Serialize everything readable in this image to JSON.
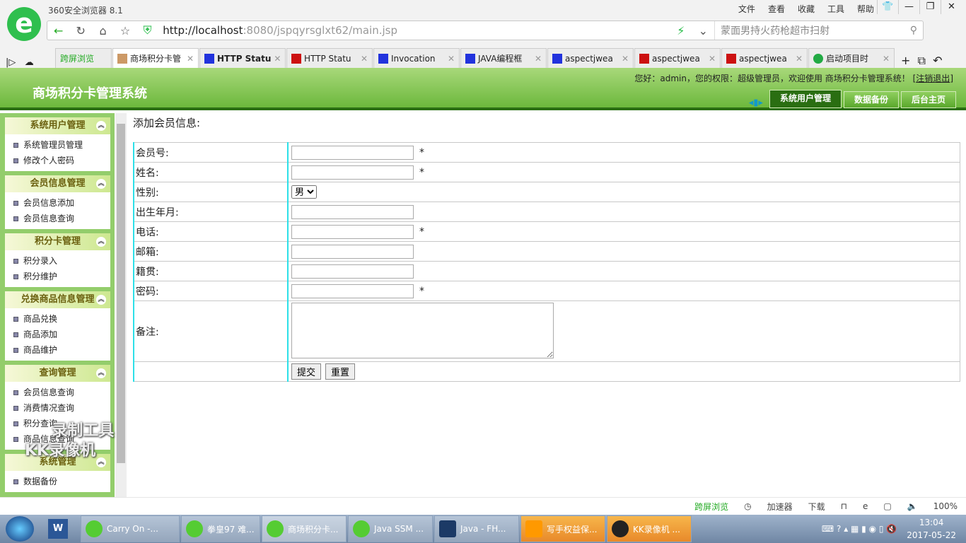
{
  "browser": {
    "title": "360安全浏览器 8.1",
    "menu": [
      "文件",
      "查看",
      "收藏",
      "工具",
      "帮助"
    ],
    "url_host": "http://localhost",
    "url_rest": ":8080/jspqyrsglxt62/main.jsp",
    "search_placeholder": "蒙面男持火药枪超市扫射",
    "tabs": [
      "跨屏浏览",
      "商场积分卡管",
      "HTTP Statu",
      "HTTP Statu",
      "Invocation",
      "JAVA编程框",
      "aspectjwea",
      "aspectjwea",
      "aspectjwea",
      "启动项目时"
    ],
    "status": {
      "crossscreen": "跨屏浏览",
      "accelerator": "加速器",
      "download": "下载",
      "zoom": "100%"
    }
  },
  "header": {
    "title": "商场积分卡管理系统",
    "welcome": "您好：admin，您的权限：超级管理员，欢迎使用 商场积分卡管理系统！",
    "logout": "注销退出",
    "nav": [
      "系统用户管理",
      "数据备份",
      "后台主页"
    ]
  },
  "sidebar": [
    {
      "title": "系统用户管理",
      "items": [
        "系统管理员管理",
        "修改个人密码"
      ]
    },
    {
      "title": "会员信息管理",
      "items": [
        "会员信息添加",
        "会员信息查询"
      ]
    },
    {
      "title": "积分卡管理",
      "items": [
        "积分录入",
        "积分维护"
      ]
    },
    {
      "title": "兑换商品信息管理",
      "items": [
        "商品兑换",
        "商品添加",
        "商品维护"
      ]
    },
    {
      "title": "查询管理",
      "items": [
        "会员信息查询",
        "消费情况查询",
        "积分查询",
        "商品信息查询"
      ]
    },
    {
      "title": "系统管理",
      "items": [
        "数据备份"
      ]
    }
  ],
  "form": {
    "title": "添加会员信息:",
    "fields": {
      "member_no": "会员号:",
      "name": "姓名:",
      "gender": "性别:",
      "birth": "出生年月:",
      "phone": "电话:",
      "email": "邮箱:",
      "hometown": "籍贯:",
      "password": "密码:",
      "remark": "备注:"
    },
    "required_mark": "*",
    "gender_value": "男",
    "submit": "提交",
    "reset": "重置"
  },
  "watermark": "录制工具 KK录像机",
  "taskbar": {
    "items": [
      "Carry On -...",
      "拳皇97 难...",
      "商场积分卡...",
      "Java SSM ...",
      "Java - FH...",
      "写手权益保...",
      "KK录像机 ..."
    ],
    "time": "13:04",
    "date": "2017-05-22"
  }
}
